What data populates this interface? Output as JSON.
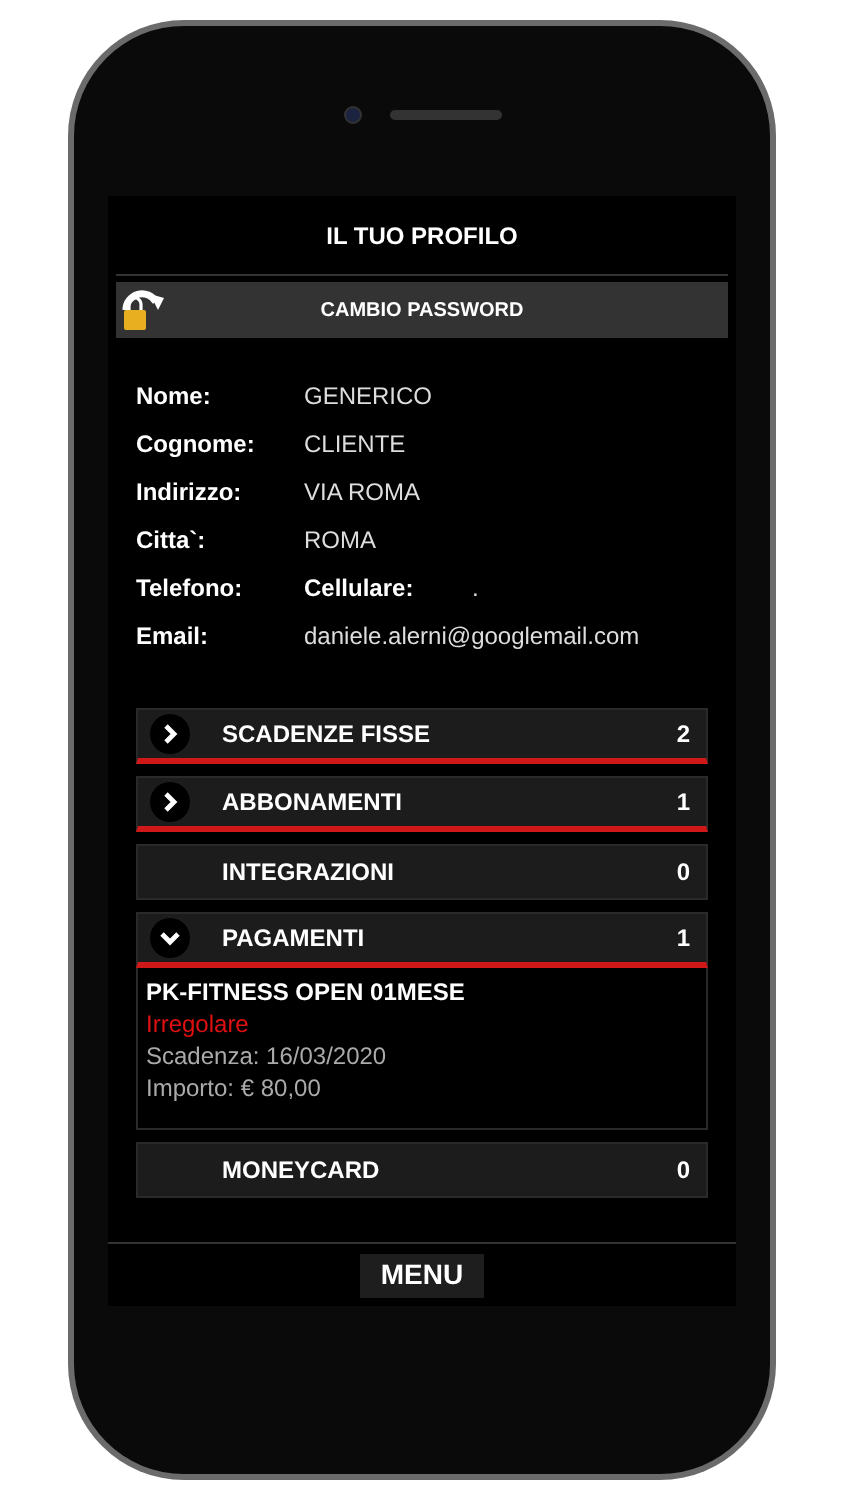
{
  "header": {
    "title": "IL TUO PROFILO"
  },
  "password_button": {
    "label": "CAMBIO PASSWORD"
  },
  "profile": [
    {
      "label": "Nome:",
      "value": "GENERICO"
    },
    {
      "label": "Cognome:",
      "value": "CLIENTE"
    },
    {
      "label": "Indirizzo:",
      "value": "VIA ROMA"
    },
    {
      "label": "Citta`:",
      "value": "ROMA"
    },
    {
      "label": "Telefono:",
      "sublabel": "Cellulare:",
      "value": "."
    },
    {
      "label": "Email:",
      "value": "daniele.alerni@googlemail.com"
    }
  ],
  "sections": [
    {
      "kind": "expandable",
      "title": "SCADENZE FISSE",
      "count": "2",
      "expanded": false
    },
    {
      "kind": "expandable",
      "title": "ABBONAMENTI",
      "count": "1",
      "expanded": false
    },
    {
      "kind": "plain",
      "title": "INTEGRAZIONI",
      "count": "0"
    },
    {
      "kind": "expandable",
      "title": "PAGAMENTI",
      "count": "1",
      "expanded": true,
      "details": {
        "name": "PK-FITNESS OPEN 01MESE",
        "status": "Irregolare",
        "lines": [
          "Scadenza: 16/03/2020",
          "Importo: € 80,00"
        ]
      }
    },
    {
      "kind": "plain",
      "title": "MONEYCARD",
      "count": "0"
    }
  ],
  "menu": {
    "label": "MENU"
  }
}
